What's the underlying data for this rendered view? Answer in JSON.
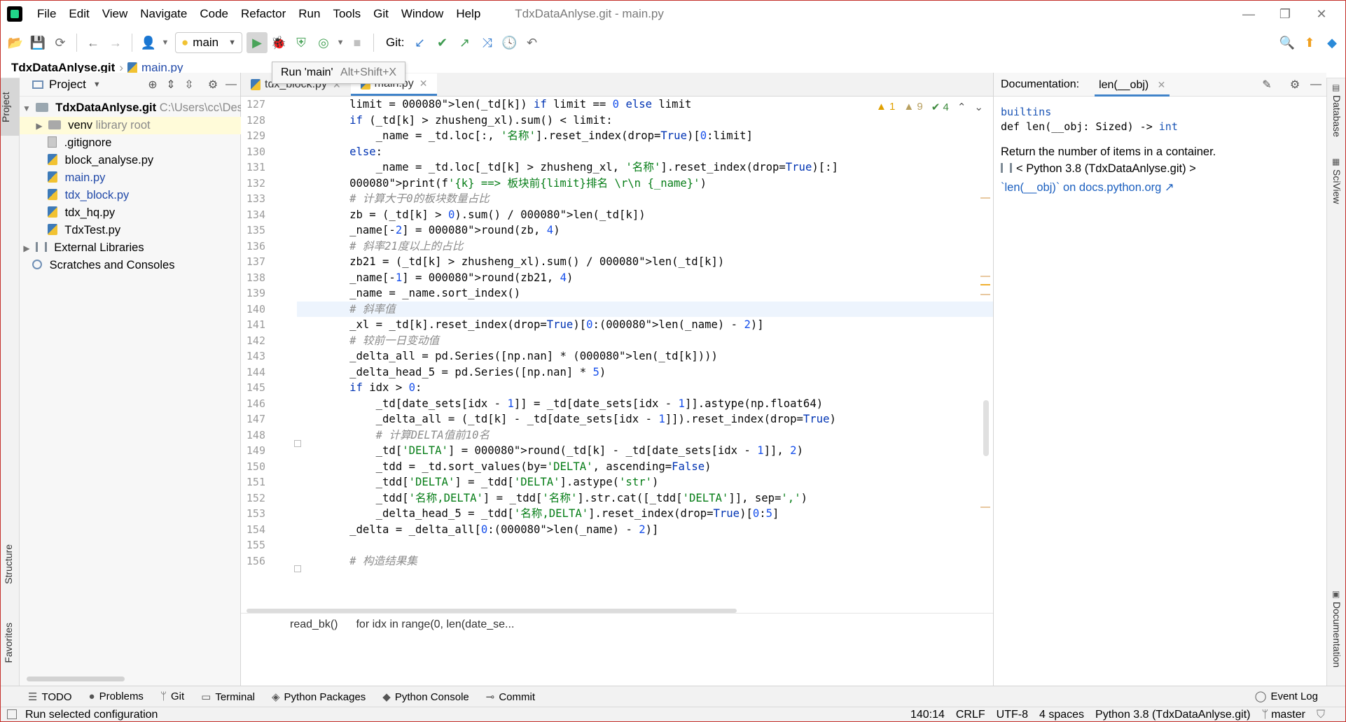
{
  "menubar": {
    "items": [
      "File",
      "Edit",
      "View",
      "Navigate",
      "Code",
      "Refactor",
      "Run",
      "Tools",
      "Git",
      "Window",
      "Help"
    ],
    "window_title": "TdxDataAnlyse.git - main.py"
  },
  "toolbar": {
    "branch": "main",
    "git_label": "Git:"
  },
  "tooltip": {
    "label": "Run 'main'",
    "shortcut": "Alt+Shift+X"
  },
  "navbar": {
    "project": "TdxDataAnlyse.git",
    "file": "main.py"
  },
  "project_panel": {
    "title": "Project",
    "root_name": "TdxDataAnlyse.git",
    "root_path": "C:\\Users\\cc\\Des",
    "venv": "venv",
    "venv_hint": "library root",
    "files": [
      ".gitignore",
      "block_analyse.py",
      "main.py",
      "tdx_block.py",
      "tdx_hq.py",
      "TdxTest.py"
    ],
    "external": "External Libraries",
    "scratches": "Scratches and Consoles"
  },
  "left_strip": {
    "project": "Project",
    "structure": "Structure",
    "favorites": "Favorites"
  },
  "editor": {
    "tabs": [
      {
        "label": "tdx_block.py"
      },
      {
        "label": "main.py"
      }
    ],
    "inspections": {
      "warnings": "1",
      "weak": "9",
      "ok": "4"
    },
    "lines": [
      {
        "n": "127",
        "code": "        limit = len(_td[k]) if limit == 0 else limit"
      },
      {
        "n": "128",
        "code": "        if (_td[k] > zhusheng_xl).sum() < limit:"
      },
      {
        "n": "129",
        "code": "            _name = _td.loc[:, '名称'].reset_index(drop=True)[0:limit]"
      },
      {
        "n": "130",
        "code": "        else:"
      },
      {
        "n": "131",
        "code": "            _name = _td.loc[_td[k] > zhusheng_xl, '名称'].reset_index(drop=True)[:]"
      },
      {
        "n": "132",
        "code": "        print(f'{k} ==> 板块前{limit}排名 \\r\\n {_name}')"
      },
      {
        "n": "133",
        "code": "        # 计算大于0的板块数量占比"
      },
      {
        "n": "134",
        "code": "        zb = (_td[k] > 0).sum() / len(_td[k])"
      },
      {
        "n": "135",
        "code": "        _name[-2] = round(zb, 4)"
      },
      {
        "n": "136",
        "code": "        # 斜率21度以上的占比"
      },
      {
        "n": "137",
        "code": "        zb21 = (_td[k] > zhusheng_xl).sum() / len(_td[k])"
      },
      {
        "n": "138",
        "code": "        _name[-1] = round(zb21, 4)"
      },
      {
        "n": "139",
        "code": "        _name = _name.sort_index()"
      },
      {
        "n": "140",
        "code": "        # 斜率值"
      },
      {
        "n": "141",
        "code": "        _xl = _td[k].reset_index(drop=True)[0:(len(_name) - 2)]"
      },
      {
        "n": "142",
        "code": "        # 较前一日变动值"
      },
      {
        "n": "143",
        "code": "        _delta_all = pd.Series([np.nan] * (len(_td[k])))"
      },
      {
        "n": "144",
        "code": "        _delta_head_5 = pd.Series([np.nan] * 5)"
      },
      {
        "n": "145",
        "code": "        if idx > 0:"
      },
      {
        "n": "146",
        "code": "            _td[date_sets[idx - 1]] = _td[date_sets[idx - 1]].astype(np.float64)"
      },
      {
        "n": "147",
        "code": "            _delta_all = (_td[k] - _td[date_sets[idx - 1]]).reset_index(drop=True)"
      },
      {
        "n": "148",
        "code": "            # 计算DELTA值前10名"
      },
      {
        "n": "149",
        "code": "            _td['DELTA'] = round(_td[k] - _td[date_sets[idx - 1]], 2)"
      },
      {
        "n": "150",
        "code": "            _tdd = _td.sort_values(by='DELTA', ascending=False)"
      },
      {
        "n": "151",
        "code": "            _tdd['DELTA'] = _tdd['DELTA'].astype('str')"
      },
      {
        "n": "152",
        "code": "            _tdd['名称,DELTA'] = _tdd['名称'].str.cat([_tdd['DELTA']], sep=',')"
      },
      {
        "n": "153",
        "code": "            _delta_head_5 = _tdd['名称,DELTA'].reset_index(drop=True)[0:5]"
      },
      {
        "n": "154",
        "code": "        _delta = _delta_all[0:(len(_name) - 2)]"
      },
      {
        "n": "155",
        "code": ""
      },
      {
        "n": "156",
        "code": "        # 构造结果集"
      }
    ],
    "breadcrumb": [
      "read_bk()",
      "for idx in range(0, len(date_se..."
    ]
  },
  "doc_panel": {
    "title": "Documentation:",
    "tab": "len(__obj)",
    "module": "builtins",
    "signature_prefix": "def len(__obj: Sized) -> ",
    "signature_type": "int",
    "description": "Return the number of items in a container.",
    "python": "< Python 3.8 (TdxDataAnlyse.git) >",
    "link": "`len(__obj)` on docs.python.org ↗"
  },
  "right_strip": {
    "database": "Database",
    "sciview": "SciView",
    "documentation": "Documentation"
  },
  "bottom_tabs": {
    "items": [
      "TODO",
      "Problems",
      "Git",
      "Terminal",
      "Python Packages",
      "Python Console",
      "Commit"
    ],
    "event_log": "Event Log"
  },
  "statusbar": {
    "message": "Run selected configuration",
    "position": "140:14",
    "line_sep": "CRLF",
    "encoding": "UTF-8",
    "indent": "4 spaces",
    "interpreter": "Python 3.8 (TdxDataAnlyse.git)",
    "branch": "master"
  }
}
